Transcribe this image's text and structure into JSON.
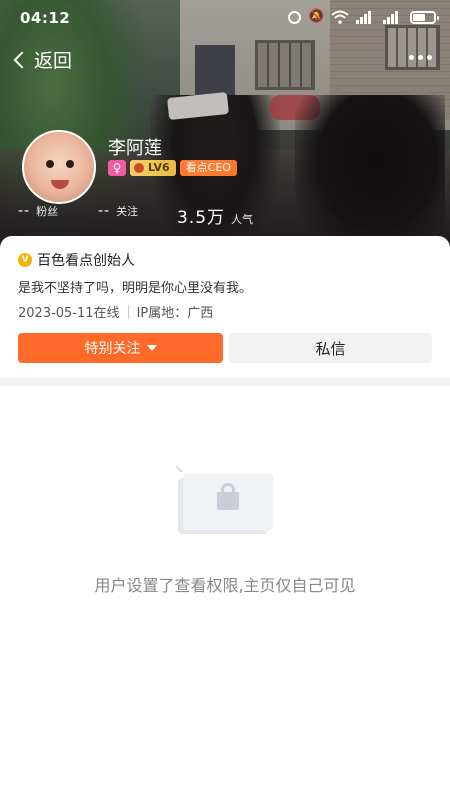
{
  "status_bar": {
    "time": "04:12",
    "icons": [
      "alarm-icon",
      "mute-icon",
      "wifi-icon",
      "signal-icon",
      "signal-icon",
      "battery-icon"
    ]
  },
  "nav": {
    "back_label": "返回",
    "more_icon": "more-dots-icon"
  },
  "profile": {
    "name": "李阿莲",
    "gender_symbol": "♀",
    "level": "LV6",
    "tag": "看点CEO",
    "stats": {
      "fans_value": "--",
      "fans_label": "粉丝",
      "following_value": "--",
      "following_label": "关注",
      "popularity_value": "3.5万",
      "popularity_label": "人气"
    }
  },
  "card": {
    "verified_title": "百色看点创始人",
    "bio": "是我不坚持了吗，明明是你心里没有我。",
    "last_online": "2023-05-11在线",
    "ip_location": "IP属地：广西",
    "follow_button": "特别关注",
    "message_button": "私信"
  },
  "empty_state": {
    "message": "用户设置了查看权限,主页仅自己可见",
    "icon": "lock-icon"
  },
  "colors": {
    "accent": "#ff6a2a",
    "ceo_badge": "#ff7a2e",
    "gender_badge": "#f05d9e",
    "level_badge": "#e9b942",
    "verified": "#f5b400"
  }
}
